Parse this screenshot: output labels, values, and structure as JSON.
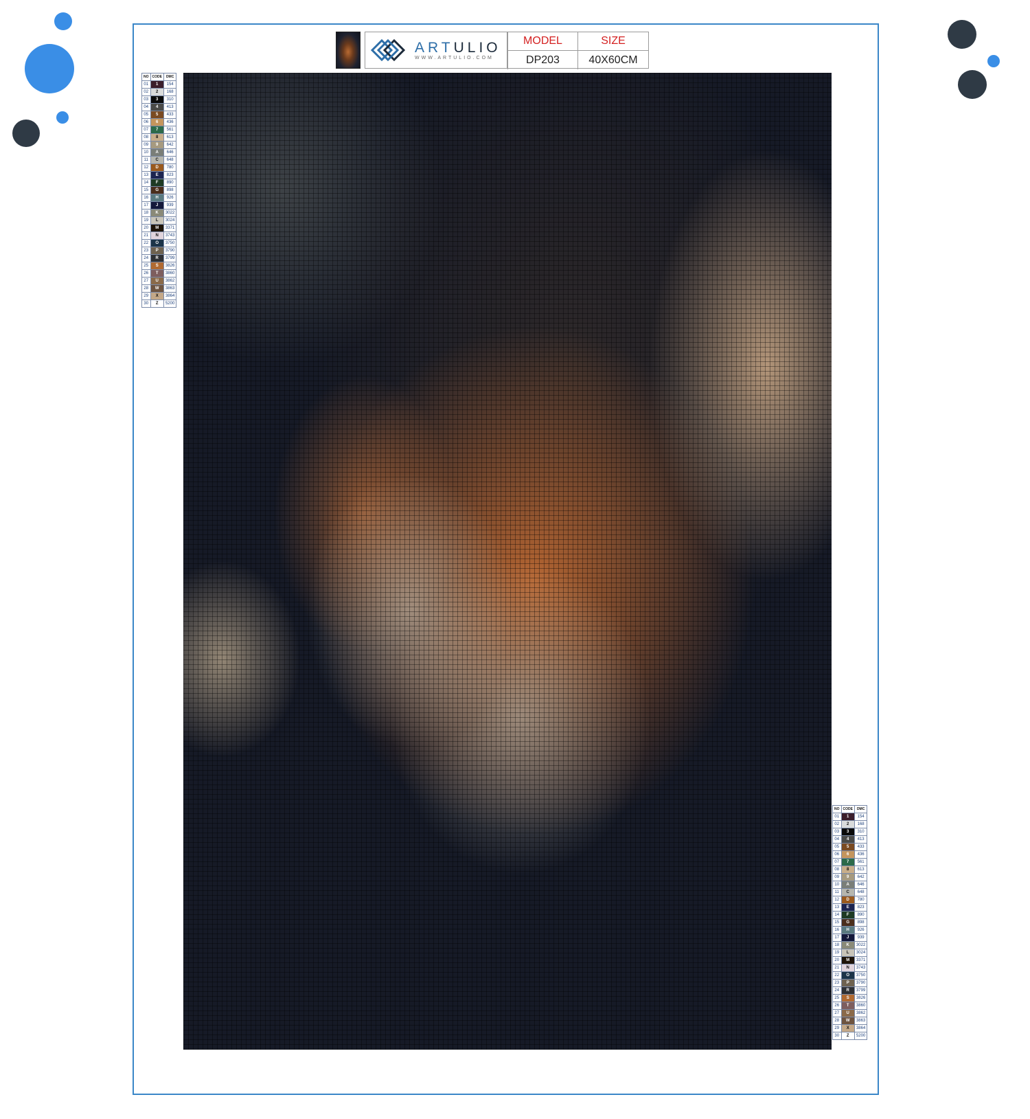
{
  "colors": {
    "frame": "#3a86c8",
    "accent_blue": "#3a8ee6",
    "dark_dot": "#2f3a45",
    "model_label": "#d42020"
  },
  "decor_icons": [
    "blue-circle-icon",
    "dark-circle-icon"
  ],
  "header": {
    "brand_name_1": "ART",
    "brand_name_2": "ULIO",
    "brand_url": "WWW.ARTULIO.COM",
    "model_label": "MODEL",
    "size_label": "SIZE",
    "model_value": "DP203",
    "size_value": "40X60CM"
  },
  "legend": {
    "headers": [
      "NO",
      "CODE",
      "DMC"
    ],
    "rows": [
      {
        "no": "01",
        "code": "1",
        "dmc": "154",
        "color": "#3b1e2b"
      },
      {
        "no": "02",
        "code": "2",
        "dmc": "168",
        "color": "#d9dbdb"
      },
      {
        "no": "03",
        "code": "3",
        "dmc": "310",
        "color": "#0a0a0a"
      },
      {
        "no": "04",
        "code": "4",
        "dmc": "413",
        "color": "#4a4a48"
      },
      {
        "no": "05",
        "code": "5",
        "dmc": "433",
        "color": "#7a4a22"
      },
      {
        "no": "06",
        "code": "6",
        "dmc": "436",
        "color": "#c4955d"
      },
      {
        "no": "07",
        "code": "7",
        "dmc": "561",
        "color": "#2c6a4a"
      },
      {
        "no": "08",
        "code": "8",
        "dmc": "613",
        "color": "#c8ae8a"
      },
      {
        "no": "09",
        "code": "9",
        "dmc": "642",
        "color": "#a69a80"
      },
      {
        "no": "10",
        "code": "A",
        "dmc": "646",
        "color": "#7a7e78"
      },
      {
        "no": "11",
        "code": "C",
        "dmc": "648",
        "color": "#b6b6ae"
      },
      {
        "no": "12",
        "code": "D",
        "dmc": "780",
        "color": "#9a5a1e"
      },
      {
        "no": "13",
        "code": "E",
        "dmc": "823",
        "color": "#1c2450"
      },
      {
        "no": "14",
        "code": "F",
        "dmc": "890",
        "color": "#1e3a24"
      },
      {
        "no": "15",
        "code": "G",
        "dmc": "898",
        "color": "#4a2e1c"
      },
      {
        "no": "16",
        "code": "H",
        "dmc": "926",
        "color": "#5a7a80"
      },
      {
        "no": "17",
        "code": "J",
        "dmc": "939",
        "color": "#14183a"
      },
      {
        "no": "18",
        "code": "K",
        "dmc": "3022",
        "color": "#8a8a78"
      },
      {
        "no": "19",
        "code": "L",
        "dmc": "3024",
        "color": "#c8c4b8"
      },
      {
        "no": "20",
        "code": "M",
        "dmc": "3371",
        "color": "#1e1408"
      },
      {
        "no": "21",
        "code": "N",
        "dmc": "3743",
        "color": "#e0d4dc"
      },
      {
        "no": "22",
        "code": "O",
        "dmc": "3750",
        "color": "#1c3448"
      },
      {
        "no": "23",
        "code": "P",
        "dmc": "3790",
        "color": "#6e6250"
      },
      {
        "no": "24",
        "code": "R",
        "dmc": "3799",
        "color": "#2e3034"
      },
      {
        "no": "25",
        "code": "S",
        "dmc": "3826",
        "color": "#b06a32"
      },
      {
        "no": "26",
        "code": "T",
        "dmc": "3860",
        "color": "#7e5e5e"
      },
      {
        "no": "27",
        "code": "U",
        "dmc": "3862",
        "color": "#8a6a4a"
      },
      {
        "no": "28",
        "code": "W",
        "dmc": "3863",
        "color": "#6e5440"
      },
      {
        "no": "29",
        "code": "X",
        "dmc": "3864",
        "color": "#c4a888"
      },
      {
        "no": "30",
        "code": "Z",
        "dmc": "5200",
        "color": "#ffffff"
      }
    ]
  }
}
